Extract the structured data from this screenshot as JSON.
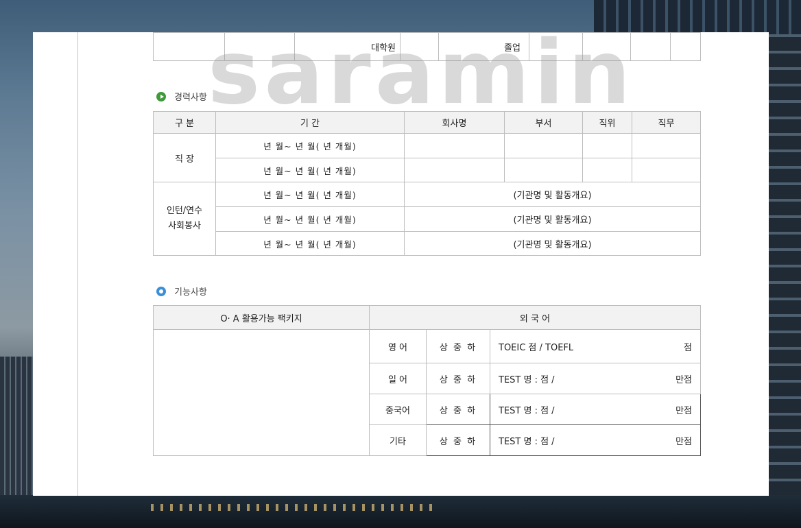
{
  "watermark": "saramin",
  "edu": {
    "school": "대학원",
    "status": "졸업"
  },
  "career": {
    "title": "경력사항",
    "headers": [
      "구  분",
      "기     간",
      "회사명",
      "부서",
      "직위",
      "직무"
    ],
    "job_label": "직  장",
    "period_template": "년   월~   년   월(  년   개월)",
    "intern_label_1": "인턴/연수",
    "intern_label_2": "사회봉사",
    "intern_desc": "(기관명 및 활동개요)"
  },
  "skills": {
    "title": "기능사항",
    "oa_header": "O· A 활용가능 팩키지",
    "lang_header": "외          국          어",
    "levels": "상 중 하",
    "rows": [
      {
        "lang": "영  어",
        "test_left": "TOEIC          점  /  TOEFL",
        "test_right": "점"
      },
      {
        "lang": "일  어",
        "test_left": "TEST 명 :                점 /",
        "test_right": "만점"
      },
      {
        "lang": "중국어",
        "test_left": "TEST 명 :                점 /",
        "test_right": "만점"
      },
      {
        "lang": "기타",
        "test_left": "TEST 명 :                점 /",
        "test_right": "만점"
      }
    ]
  }
}
